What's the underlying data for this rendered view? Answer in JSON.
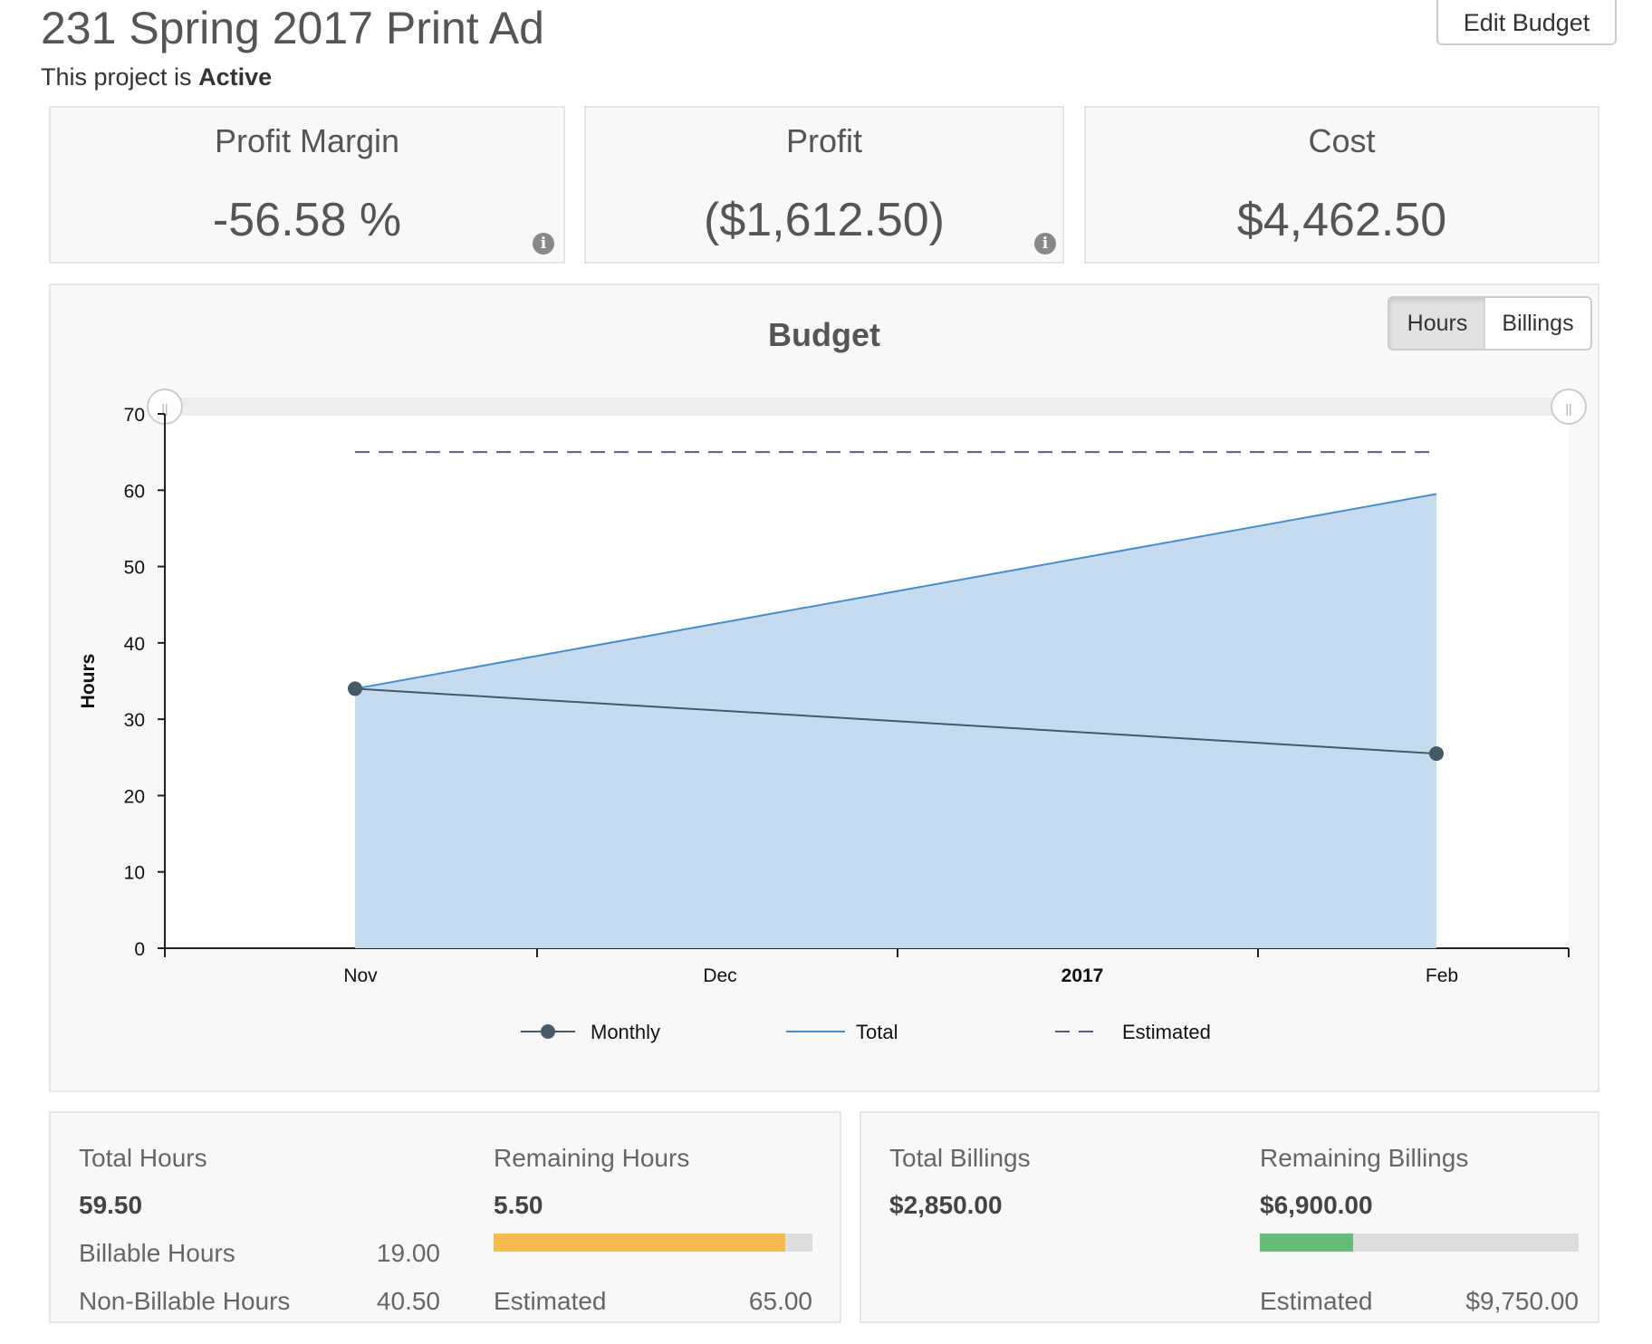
{
  "header": {
    "title": "231 Spring 2017 Print Ad",
    "status_prefix": "This project is",
    "status_value": "Active",
    "edit_budget_label": "Edit Budget"
  },
  "kpis": {
    "profit_margin": {
      "label": "Profit Margin",
      "value": "-56.58 %"
    },
    "profit": {
      "label": "Profit",
      "value": "($1,612.50)"
    },
    "cost": {
      "label": "Cost",
      "value": "$4,462.50"
    },
    "info_icon_glyph": "i"
  },
  "budget_chart": {
    "title": "Budget",
    "toggle_hours": "Hours",
    "toggle_billings": "Billings",
    "active_toggle": "Hours",
    "range_handle_glyph": "||"
  },
  "chart_data": {
    "type": "line",
    "title": "Budget",
    "xlabel": "",
    "ylabel": "Hours",
    "ylim": [
      0,
      70
    ],
    "yticks": [
      0,
      10,
      20,
      30,
      40,
      50,
      60,
      70
    ],
    "xticks": [
      {
        "label": "Nov",
        "bold": false
      },
      {
        "label": "Dec",
        "bold": false
      },
      {
        "label": "2017",
        "bold": true
      },
      {
        "label": "Feb",
        "bold": false
      }
    ],
    "x": [
      "Nov 2016",
      "Feb 2017"
    ],
    "series": [
      {
        "name": "Monthly",
        "style": "line-markers",
        "color": "#455a64",
        "values": [
          34.0,
          25.5
        ]
      },
      {
        "name": "Total",
        "style": "area",
        "color": "#4a8cc9",
        "fill": "#c5dcf0",
        "values": [
          34.0,
          59.5
        ]
      },
      {
        "name": "Estimated",
        "style": "dashed",
        "color": "#5a5a8c",
        "values": [
          65,
          65
        ]
      }
    ],
    "legend_position": "bottom",
    "grid": false
  },
  "hours_summary": {
    "total_label": "Total Hours",
    "total_value": "59.50",
    "billable_label": "Billable Hours",
    "billable_value": "19.00",
    "non_billable_label": "Non-Billable Hours",
    "non_billable_value": "40.50",
    "remaining_label": "Remaining Hours",
    "remaining_value": "5.50",
    "progress_fraction": 0.915,
    "progress_color": "#f5bb4f",
    "estimated_label": "Estimated",
    "estimated_value": "65.00"
  },
  "billings_summary": {
    "total_label": "Total Billings",
    "total_value": "$2,850.00",
    "remaining_label": "Remaining Billings",
    "remaining_value": "$6,900.00",
    "progress_fraction": 0.292,
    "progress_color": "#66bb77",
    "estimated_label": "Estimated",
    "estimated_value": "$9,750.00"
  }
}
